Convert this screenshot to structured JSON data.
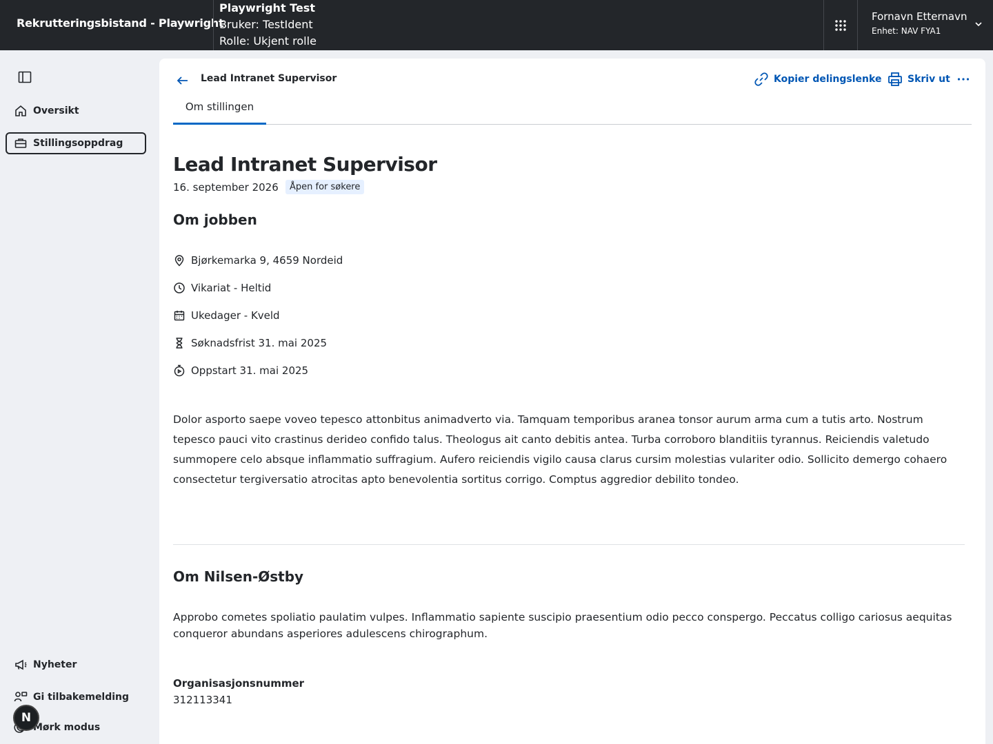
{
  "header": {
    "app_title": "Rekrutteringsbistand - Playwright",
    "test_title": "Playwright Test",
    "user_line": "Bruker: TestIdent",
    "role_line": "Rolle: Ukjent rolle",
    "user_name": "Fornavn Etternavn",
    "user_unit": "Enhet: NAV FYA1"
  },
  "sidebar": {
    "items": [
      {
        "label": "Oversikt",
        "icon": "home-icon"
      },
      {
        "label": "Stillingsoppdrag",
        "icon": "briefcase-icon",
        "active": true
      }
    ],
    "bottom": [
      {
        "label": "Nyheter",
        "icon": "megaphone-icon"
      },
      {
        "label": "Gi tilbakemelding",
        "icon": "feedback-icon"
      },
      {
        "label": "Mørk modus",
        "icon": "moon-icon"
      }
    ],
    "fab_label": "N"
  },
  "page": {
    "crumb_title": "Lead Intranet Supervisor",
    "copy_link": "Kopier delingslenke",
    "print": "Skriv ut",
    "tab": "Om stillingen",
    "title": "Lead Intranet Supervisor",
    "date": "16. september 2026",
    "status": "Åpen for søkere",
    "about_job_heading": "Om jobben",
    "facts": [
      {
        "icon": "location-icon",
        "text": "Bjørkemarka 9, 4659 Nordeid"
      },
      {
        "icon": "clock-icon",
        "text": "Vikariat - Heltid"
      },
      {
        "icon": "calendar-icon",
        "text": "Ukedager - Kveld"
      },
      {
        "icon": "hourglass-icon",
        "text": "Søknadsfrist 31. mai 2025"
      },
      {
        "icon": "stopwatch-icon",
        "text": "Oppstart 31. mai 2025"
      }
    ],
    "description": "Dolor asporto saepe voveo tepesco attonbitus animadverto via. Tamquam temporibus aranea tonsor aurum arma cum a tutis arto. Nostrum tepesco pauci vito crastinus derideo confido talus. Theologus ait canto debitis antea. Turba corroboro blanditiis tyrannus. Reiciendis valetudo summopere celo absque inflammatio suffragium. Aufero reiciendis vigilo causa clarus cursim molestias vulariter odio. Sollicito demergo cohaero consectetur tergiversatio atrocitas apto benevolentia sortitus corrigo. Comptus aggredior debilito tondeo.",
    "employer_heading": "Om Nilsen-Østby",
    "employer_text": "Approbo cometes spoliatio paulatim vulpes. Inflammatio sapiente suscipio praesentium odio pecco conspergo. Peccatus colligo cariosus aequitas conqueror abundans asperiores adulescens chirographum.",
    "org_label": "Organisasjonsnummer",
    "org_number": "312113341"
  },
  "colors": {
    "header_bg": "#23262a",
    "accent": "#0067c5",
    "link": "#0056b4",
    "badge_bg": "#e6f0ff",
    "page_bg": "#eef0f4"
  }
}
